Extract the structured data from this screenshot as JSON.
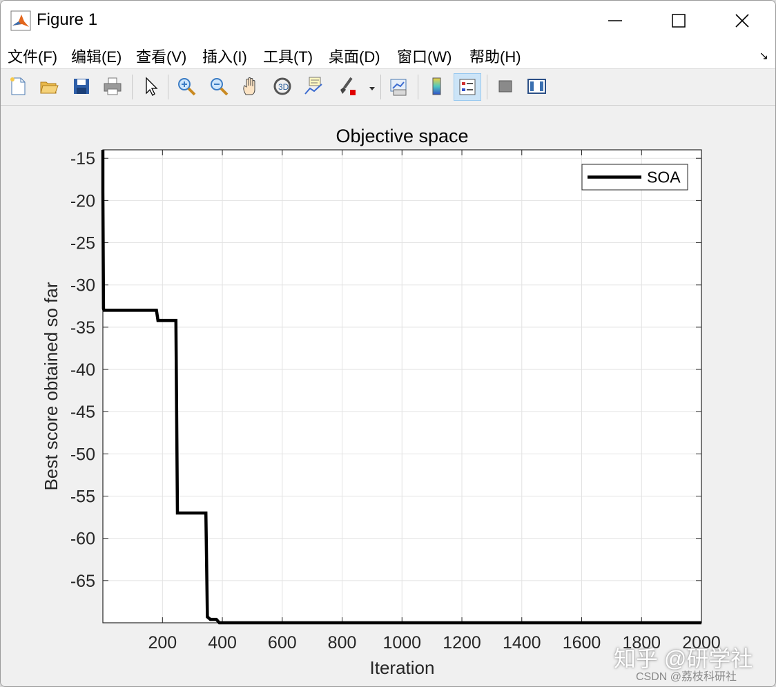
{
  "window": {
    "title": "Figure 1"
  },
  "menu": {
    "items": [
      "文件(F)",
      "编辑(E)",
      "查看(V)",
      "插入(I)",
      "工具(T)",
      "桌面(D)",
      "窗口(W)",
      "帮助(H)"
    ]
  },
  "toolbar": {
    "buttons": [
      "new-figure",
      "open-file",
      "save",
      "print",
      "edit-plot",
      "zoom-in",
      "zoom-out",
      "pan",
      "rotate-3d",
      "data-cursor",
      "brush",
      "link-plot",
      "colorbar",
      "legend",
      "hide-plot-tools",
      "show-plot-tools"
    ]
  },
  "chart_data": {
    "type": "line",
    "title": "Objective space",
    "xlabel": "Iteration",
    "ylabel": "Best score obtained so far",
    "xlim": [
      1,
      2000
    ],
    "ylim": [
      -70.0,
      -14.0
    ],
    "xticks": [
      200,
      400,
      600,
      800,
      1000,
      1200,
      1400,
      1600,
      1800,
      2000
    ],
    "yticks": [
      -15,
      -20,
      -25,
      -30,
      -35,
      -40,
      -45,
      -50,
      -55,
      -60,
      -65
    ],
    "xtick_labels": [
      "200",
      "400",
      "600",
      "800",
      "1000",
      "1200",
      "1400",
      "1600",
      "1800",
      "2000"
    ],
    "ytick_labels": [
      "-15",
      "-20",
      "-25",
      "-30",
      "-35",
      "-40",
      "-45",
      "-50",
      "-55",
      "-60",
      "-65"
    ],
    "grid": true,
    "legend": "top-right",
    "series": [
      {
        "name": "SOA",
        "color": "#000000",
        "x": [
          1,
          1,
          3,
          5,
          180,
          185,
          245,
          250,
          345,
          350,
          360,
          380,
          390,
          2000
        ],
        "y": [
          -14.0,
          -19.0,
          -32.8,
          -33.0,
          -33.0,
          -34.2,
          -34.2,
          -57.0,
          -57.0,
          -69.3,
          -69.6,
          -69.6,
          -70.0,
          -70.0
        ]
      }
    ]
  },
  "watermark": {
    "line1": "知乎 @研学社",
    "line2": "CSDN @荔枝科研社"
  }
}
